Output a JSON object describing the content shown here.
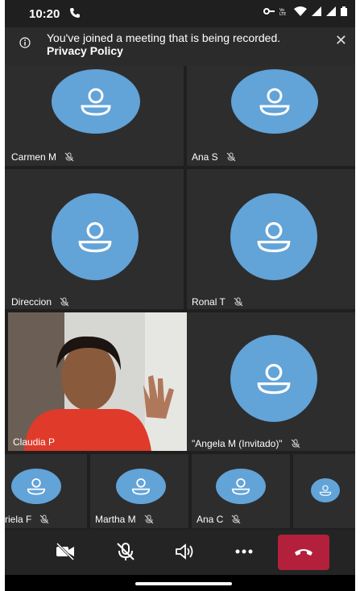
{
  "status_bar": {
    "time": "10:20"
  },
  "banner": {
    "message": "You've joined a meeting that is being recorded.",
    "link": "Privacy Policy"
  },
  "participants": {
    "carmen": "Carmen M",
    "ana_s": "Ana S",
    "direccion": "Direccion",
    "ronal": "Ronal T",
    "claudia": "Claudia P",
    "angela": "\"Angela M (Invitado)\"",
    "gabriela": "riela F",
    "martha": "Martha M",
    "ana_c": "Ana C"
  },
  "colors": {
    "avatar": "#62a3d8",
    "hangup": "#b3203b",
    "tile": "#2d2d2d"
  },
  "icons": [
    "phone-icon",
    "info-icon",
    "close-icon",
    "camera-off-icon",
    "mic-off-icon",
    "speaker-icon",
    "more-icon",
    "hangup-icon"
  ]
}
